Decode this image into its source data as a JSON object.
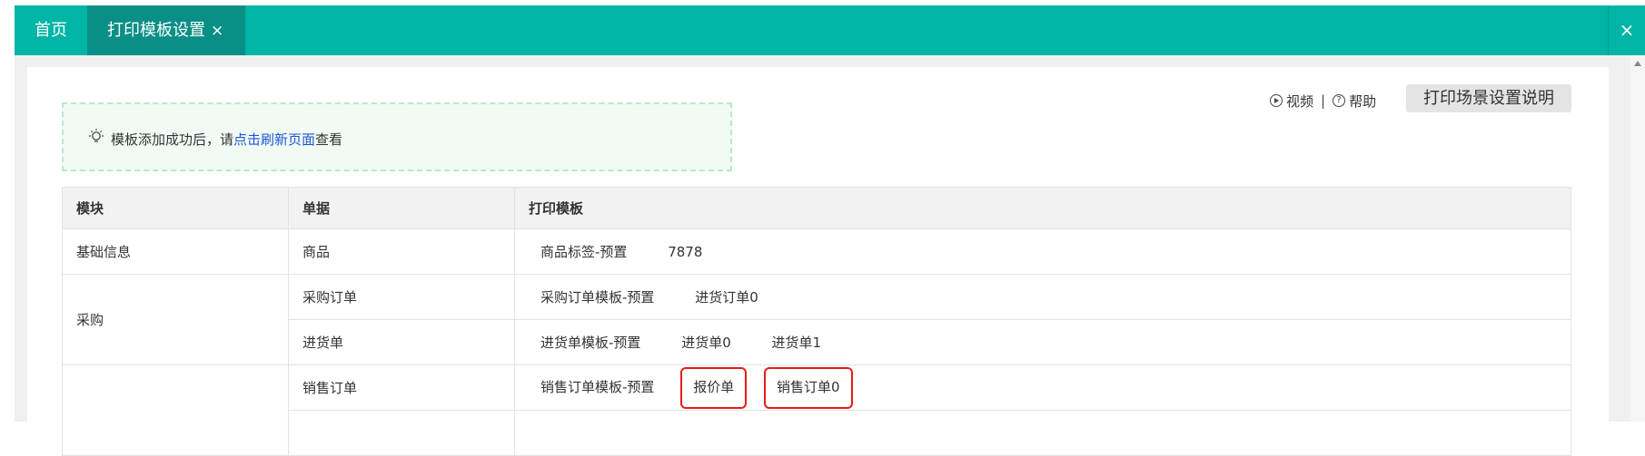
{
  "tabs": {
    "home_label": "首页",
    "active_label": "打印模板设置",
    "active_close": "×",
    "close_all": "×"
  },
  "notice": {
    "prefix": "模板添加成功后，请",
    "link": "点击刷新页面",
    "suffix": "查看"
  },
  "help": {
    "video_label": "视频",
    "separator": "|",
    "help_label": "帮助"
  },
  "scene_button_label": "打印场景设置说明",
  "table": {
    "headers": [
      "模块",
      "单据",
      "打印模板"
    ],
    "rows": [
      {
        "module": "基础信息",
        "doc": "商品",
        "templates": [
          "商品标签-预置",
          "7878"
        ]
      },
      {
        "module": "采购",
        "doc": "采购订单",
        "templates": [
          "采购订单模板-预置",
          "进货订单0"
        ]
      },
      {
        "module": "",
        "doc": "进货单",
        "templates": [
          "进货单模板-预置",
          "进货单0",
          "进货单1"
        ]
      },
      {
        "module": "",
        "doc": "销售订单",
        "templates": [
          "销售订单模板-预置",
          "报价单",
          "销售订单0"
        ]
      }
    ]
  },
  "colors": {
    "accent": "#00b4a6",
    "active_tab": "#0a8f86",
    "highlight": "#e81a1a",
    "link": "#1f54d6"
  }
}
